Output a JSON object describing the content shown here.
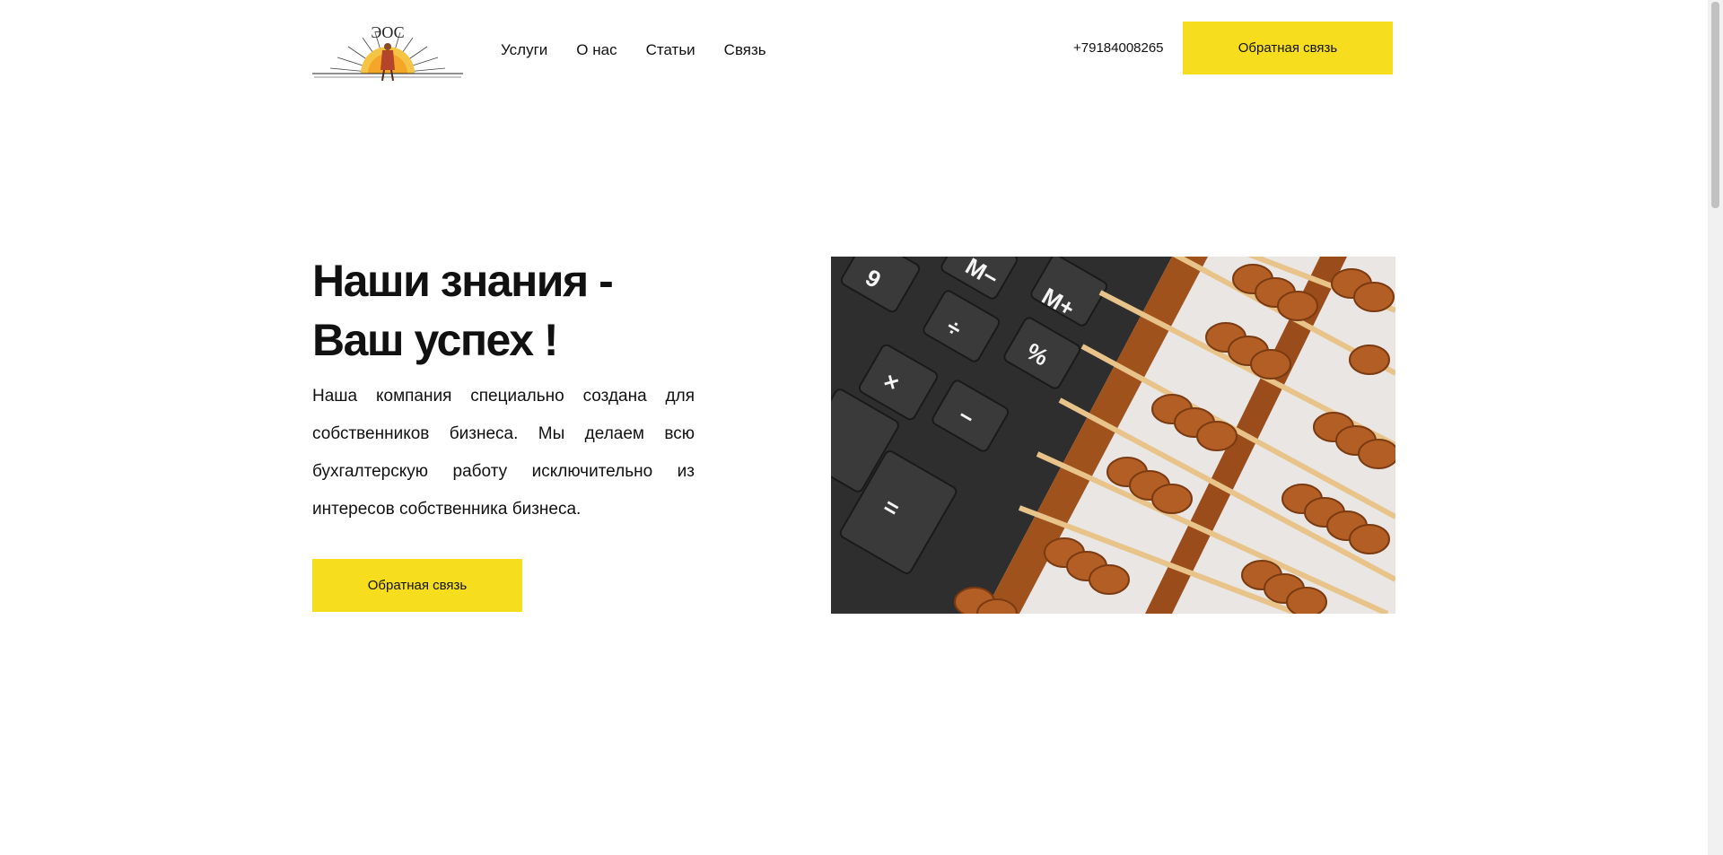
{
  "header": {
    "logo_alt": "ЭОС",
    "nav": [
      {
        "label": "Услуги"
      },
      {
        "label": "О нас"
      },
      {
        "label": "Статьи"
      },
      {
        "label": "Связь"
      }
    ],
    "phone": "+79184008265",
    "callback_label": "Обратная связь"
  },
  "hero": {
    "title_line1": "Наши знания -",
    "title_line2": "Ваш успех !",
    "text": "Наша компания специально создана для собственников бизнеса. Мы делаем всю бухгалтерскую работу исключительно из интересов собственника бизнеса.",
    "button_label": "Обратная связь",
    "image": "calculator-and-abacus-photo"
  },
  "colors": {
    "accent": "#f6de1f",
    "text": "#111111",
    "background": "#ffffff"
  }
}
